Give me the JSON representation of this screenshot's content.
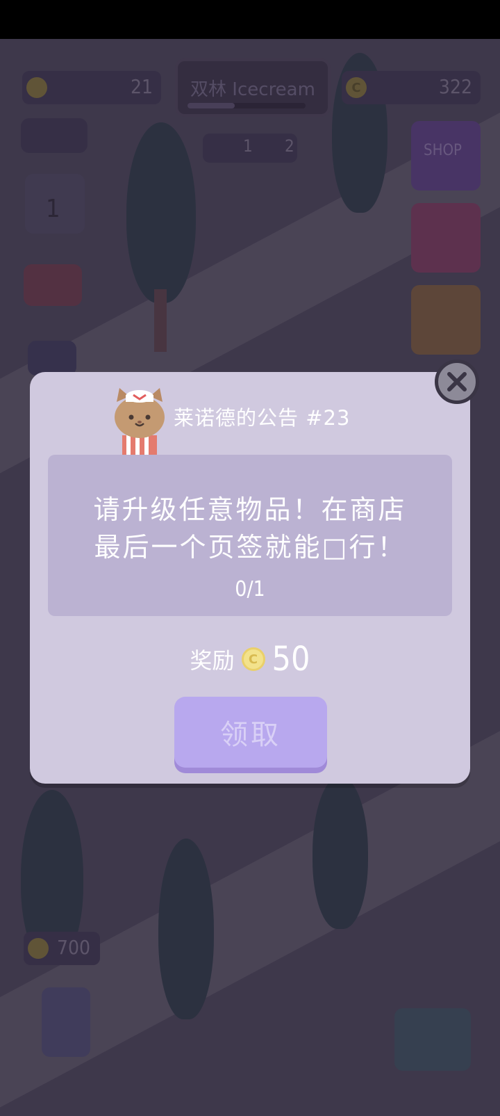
{
  "hud": {
    "level_value": "21",
    "shop_name": "双林 Icecream",
    "coins_value": "322",
    "dog_count": "1",
    "cat_count": "2",
    "calendar_day": "1",
    "shop_label": "SHOP",
    "ad_price": "700"
  },
  "dialog": {
    "title": "莱诺德的公告 #23",
    "message_line1": "请升级任意物品！在商店",
    "message_line2": "最后一个页签就能□行！",
    "progress": "0/1",
    "progress_fraction": 0,
    "reward_label": "奖励",
    "coin_symbol": "C",
    "reward_value": "50",
    "claim_label": "领取"
  },
  "colors": {
    "dialog_bg": "#d0c9df",
    "panel_bg": "#bbb2d2",
    "button_bg": "#b8a8ee",
    "coin": "#f3e28c"
  }
}
